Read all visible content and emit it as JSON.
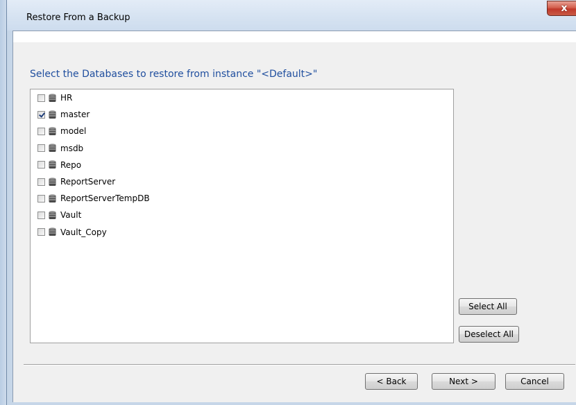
{
  "window": {
    "title": "Restore From a Backup",
    "close_glyph": "x"
  },
  "main": {
    "heading": "Select the Databases to restore from instance \"<Default>\"",
    "databases": [
      {
        "name": "HR",
        "checked": false
      },
      {
        "name": "master",
        "checked": true
      },
      {
        "name": "model",
        "checked": false
      },
      {
        "name": "msdb",
        "checked": false
      },
      {
        "name": "Repo",
        "checked": false
      },
      {
        "name": "ReportServer",
        "checked": false
      },
      {
        "name": "ReportServerTempDB",
        "checked": false
      },
      {
        "name": "Vault",
        "checked": false
      },
      {
        "name": "Vault_Copy",
        "checked": false
      }
    ],
    "select_all_label": "Select All",
    "deselect_all_label": "Deselect All"
  },
  "footer": {
    "back_label": "< Back",
    "next_label": "Next >",
    "cancel_label": "Cancel"
  },
  "icons": {
    "database": "database-icon",
    "close": "close-icon"
  },
  "colors": {
    "heading": "#1f4e9e",
    "close_button": "#c0392b",
    "frame": "#c6d6e8"
  }
}
